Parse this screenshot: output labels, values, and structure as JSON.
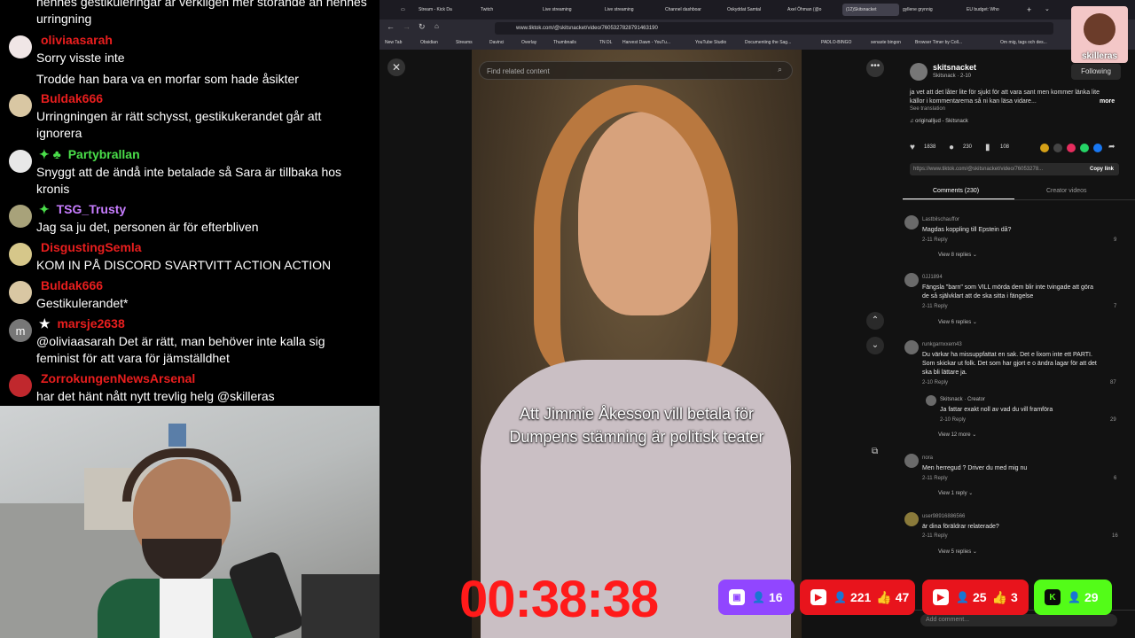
{
  "chat": {
    "top_text": "hennes gestikuleringar är verkligen mer störande än hennes urringning",
    "messages": [
      {
        "user": "oliviaasarah",
        "color": "#e91e1e",
        "avatar": "#f0e6e6",
        "text": "Sorry visste inte",
        "text2": "Trodde han bara va en morfar som hade åsikter",
        "badge": ""
      },
      {
        "user": "Buldak666",
        "color": "#e91e1e",
        "avatar": "#d9c7a3",
        "text": "Urringningen är rätt schysst, gestikukerandet går att ignorera",
        "badge": ""
      },
      {
        "user": "Partybrallan",
        "color": "#4ade4a",
        "avatar": "#e8e8e8",
        "text": "Snyggt att de ändå inte betalade så Sara är tillbaka hos kronis",
        "badge": "✦ ♣"
      },
      {
        "user": "TSG_Trusty",
        "color": "#c77dff",
        "avatar": "#a8a27a",
        "text": "Jag sa ju det, personen är för efterbliven",
        "badge": "✦"
      },
      {
        "user": "DisgustingSemla",
        "color": "#e91e1e",
        "avatar": "#d6c78a",
        "text": "KOM IN PÅ DISCORD SVARTVITT ACTION ACTION",
        "badge": ""
      },
      {
        "user": "Buldak666",
        "color": "#e91e1e",
        "avatar": "#d9c7a3",
        "text": "Gestikulerandet*",
        "badge": ""
      },
      {
        "user": "marsje2638",
        "color": "#e91e1e",
        "avatar": "#777777",
        "avatar_letter": "m",
        "text": "@oliviaasarah Det är rätt, man behöver inte kalla sig feminist för att vara för jämställdhet",
        "badge": "★"
      },
      {
        "user": "ZorrokungenNewsArsenal",
        "color": "#e91e1e",
        "avatar": "#c0282d",
        "text": "har det hänt nått nytt trevlig helg @skilleras",
        "badge": ""
      }
    ]
  },
  "browser": {
    "tabs": [
      "Stream - Kick Da",
      "Twitch",
      "Live streaming",
      "Live streaming",
      "Channel dashboar",
      "Oskyddat Samtal",
      "Axel Öhman (@o",
      "(12)Skitsnacket",
      "gyllene grynnig",
      "EU budget: Who"
    ],
    "url": "www.tiktok.com/@skitsnacket/video/7605327828791463190",
    "bookmarks": [
      "New Tab",
      "Obsidian",
      "Streams",
      "Davinci",
      "Overlay",
      "Thumbnails",
      "TN DL",
      "Harvest Dawn - YouTu...",
      "YouTube Studio",
      "Documenting the Sag...",
      "PADLO-BINGO",
      "senaste bingon",
      "Browser Timer by Coll...",
      "Om mig, tags och des..."
    ],
    "search_placeholder": "Find related content",
    "caption": "Att Jimmie Åkesson vill betala för Dumpens stämning är politisk teater",
    "creator_name": "skitsnacket",
    "creator_sub": "Skitsnack · 2-10",
    "follow_label": "Following",
    "description": "ja vet att det låter lite för sjukt för att vara sant men kommer länka lite källor i kommentarerna så ni kan läsa vidare...",
    "more_label": "more",
    "see_translation": "See translation",
    "sound": "♫ originalljud - Skitsnack",
    "likes": "1838",
    "comments_count": "230",
    "saves": "108",
    "link": "https://www.tiktok.com/@skitsnacket/video/76053278...",
    "copy_link": "Copy link",
    "tab_comments": "Comments (230)",
    "tab_creator": "Creator videos",
    "comments": [
      {
        "user": "Lastbilschauffor",
        "text": "Magdas koppling till Epstein då?",
        "meta": "2-11   Reply",
        "likes": "9",
        "more": "View 8 replies ⌄"
      },
      {
        "user": "0JJ1894",
        "text": "Fängsla \"barn\" som VILL mörda dem blir inte tvingade att göra de så självklart att de ska sitta i fängelse",
        "meta": "2-11   Reply",
        "likes": "7",
        "more": "View 6 replies ⌄"
      },
      {
        "user": "runkgarnxxem43",
        "text": "Du värkar ha missuppfattat en sak. Det e lixom inte ett PARTI. Som skickar ut folk. Det som har gjort e o ändra lagar för att det ska bli lättare ja.",
        "meta": "2-10   Reply",
        "likes": "87",
        "more": ""
      },
      {
        "user": "Skitsnack · Creator",
        "text": "Ja fattar exakt noll av vad du vill framföra",
        "meta": "2-10   Reply",
        "likes": "29",
        "more": "View 12 more ⌄"
      },
      {
        "user": "nora",
        "text": "Men herregud ? Driver du med mig nu",
        "meta": "2-11   Reply",
        "likes": "6",
        "more": "View 1 reply ⌄"
      },
      {
        "user": "user98916886566",
        "text": "är dina föräldrar relaterade?",
        "meta": "2-11   Reply",
        "likes": "16",
        "more": "View 5 replies ⌄"
      }
    ],
    "add_comment": "Add comment..."
  },
  "overlay": {
    "timer": "00:38:38",
    "counters": [
      {
        "platform": "twitch",
        "icon": "twitch-icon",
        "bg": "#9146ff",
        "value": "16",
        "likes": ""
      },
      {
        "platform": "youtube",
        "icon": "youtube-icon",
        "bg": "#e8141c",
        "value": "221",
        "likes": "47"
      },
      {
        "platform": "youtube",
        "icon": "youtube-icon",
        "bg": "#e8141c",
        "value": "25",
        "likes": "3"
      },
      {
        "platform": "kick",
        "icon": "kick-icon",
        "bg": "#53fc18",
        "value": "29",
        "likes": ""
      }
    ],
    "logo_text": "skilleras"
  }
}
